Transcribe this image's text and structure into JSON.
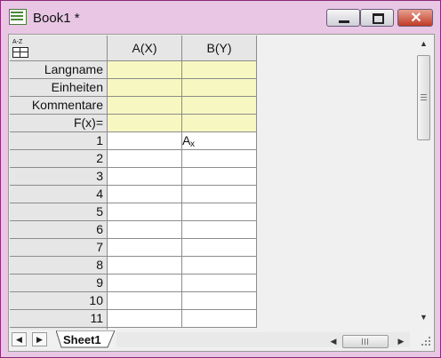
{
  "window": {
    "title": "Book1 *",
    "icons": {
      "app": "worksheet-book-icon",
      "minimize": "minimize-icon",
      "maximize": "maximize-icon",
      "close": "close-icon"
    },
    "close_glyph": "✕",
    "close_color": "#c03a26",
    "frame_color": "#e8c6e4"
  },
  "worksheet": {
    "corner_icon": "column-sort-icon",
    "corner_glyph": "A-Z",
    "columns": [
      {
        "label": "A(X)"
      },
      {
        "label": "B(Y)"
      }
    ],
    "label_rows": [
      "Langname",
      "Einheiten",
      "Kommentare",
      "F(x)="
    ],
    "label_row_color": "#f7f7c2",
    "data_rows": [
      "1",
      "2",
      "3",
      "4",
      "5",
      "6",
      "7",
      "8",
      "9",
      "10",
      "11"
    ],
    "cursor_cell_text": "A",
    "cursor_cell_subscript": "x"
  },
  "tabs": {
    "nav_first": "◀",
    "nav_next": "▶",
    "sheets": [
      {
        "label": "Sheet1",
        "active": true
      }
    ]
  },
  "scrollbars": {
    "up": "▲",
    "down": "▼",
    "left": "◀",
    "right": "▶"
  }
}
